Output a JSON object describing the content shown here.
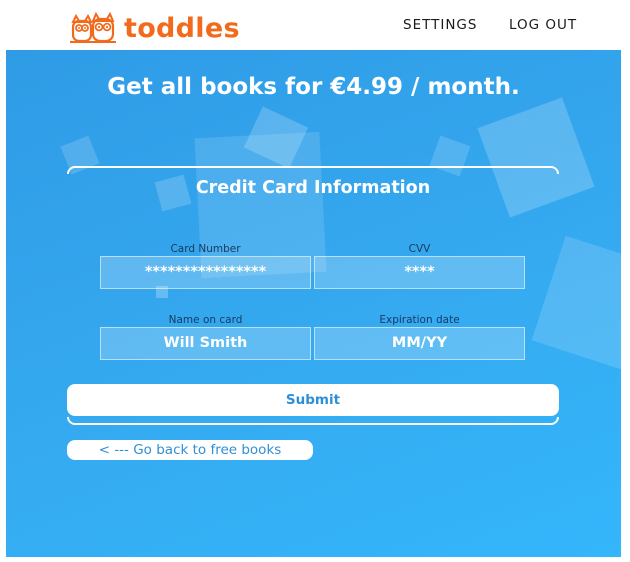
{
  "header": {
    "logo_text": "toddles",
    "nav": {
      "settings": "SETTINGS",
      "logout": "LOG OUT"
    }
  },
  "main": {
    "headline": "Get all books for €4.99 / month.",
    "card_title": "Credit Card Information",
    "fields": {
      "card_number": {
        "label": "Card Number",
        "value": "****************"
      },
      "cvv": {
        "label": "CVV",
        "value": "****"
      },
      "name_on_card": {
        "label": "Name on card",
        "value": "Will Smith"
      },
      "expiration_date": {
        "label": "Expiration date",
        "placeholder": "MM/YY"
      }
    },
    "submit_label": "Submit",
    "back_link": "< --- Go back to free books"
  },
  "colors": {
    "brand_orange": "#f26b1d",
    "panel_blue": "#35aaf0",
    "button_text_blue": "#2f8fd6"
  },
  "icons": {
    "logo": "owl-pair-logo-icon"
  }
}
